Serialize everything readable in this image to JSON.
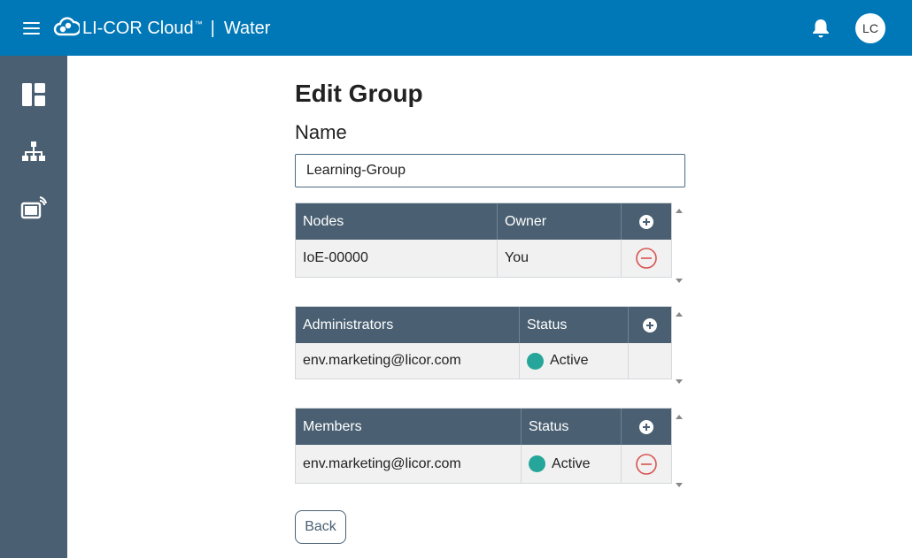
{
  "header": {
    "brand": "LI-COR Cloud",
    "trademark": "™",
    "separator": "|",
    "product": "Water",
    "avatar_initials": "LC",
    "brand_color": "#0077b6"
  },
  "sidebar": {
    "items": [
      {
        "icon": "dashboard-icon"
      },
      {
        "icon": "hierarchy-icon"
      },
      {
        "icon": "device-wireless-icon"
      }
    ],
    "color": "#4a6072"
  },
  "page": {
    "title": "Edit Group",
    "name_label": "Name",
    "name_value": "Learning-Group"
  },
  "nodes_table": {
    "columns": [
      "Nodes",
      "Owner"
    ],
    "rows": [
      {
        "node": "IoE-00000",
        "owner": "You"
      }
    ]
  },
  "admins_table": {
    "columns": [
      "Administrators",
      "Status"
    ],
    "rows": [
      {
        "email": "env.marketing@licor.com",
        "status": "Active"
      }
    ]
  },
  "members_table": {
    "columns": [
      "Members",
      "Status"
    ],
    "rows": [
      {
        "email": "env.marketing@licor.com",
        "status": "Active"
      }
    ]
  },
  "status_color": "#26a69a",
  "back_label": "Back"
}
